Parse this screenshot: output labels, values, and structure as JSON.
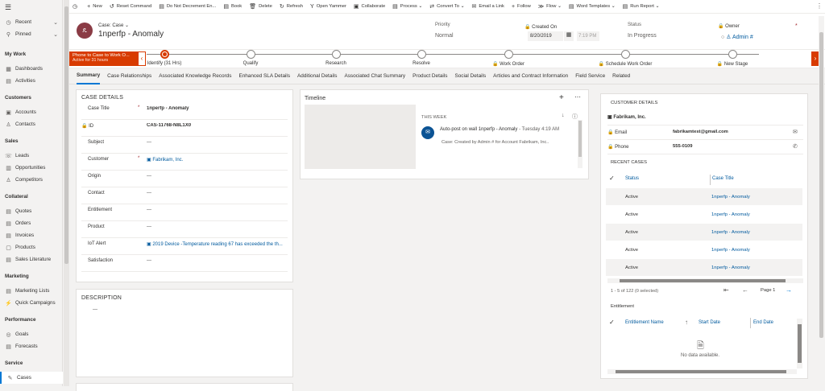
{
  "sidebar": {
    "top_items": [
      {
        "icon": "◷",
        "label": "Recent"
      },
      {
        "icon": "⚲",
        "label": "Pinned"
      }
    ],
    "sections": [
      {
        "title": "My Work",
        "items": [
          {
            "icon": "▦",
            "label": "Dashboards"
          },
          {
            "icon": "▤",
            "label": "Activities"
          }
        ]
      },
      {
        "title": "Customers",
        "items": [
          {
            "icon": "▣",
            "label": "Accounts"
          },
          {
            "icon": "♙",
            "label": "Contacts"
          }
        ]
      },
      {
        "title": "Sales",
        "items": [
          {
            "icon": "☏",
            "label": "Leads"
          },
          {
            "icon": "▥",
            "label": "Opportunities"
          },
          {
            "icon": "♙",
            "label": "Competitors"
          }
        ]
      },
      {
        "title": "Collateral",
        "items": [
          {
            "icon": "▤",
            "label": "Quotes"
          },
          {
            "icon": "▤",
            "label": "Orders"
          },
          {
            "icon": "▤",
            "label": "Invoices"
          },
          {
            "icon": "▢",
            "label": "Products"
          },
          {
            "icon": "▤",
            "label": "Sales Literature"
          }
        ]
      },
      {
        "title": "Marketing",
        "items": [
          {
            "icon": "▤",
            "label": "Marketing Lists"
          },
          {
            "icon": "⚡",
            "label": "Quick Campaigns"
          }
        ]
      },
      {
        "title": "Performance",
        "items": [
          {
            "icon": "◎",
            "label": "Goals"
          },
          {
            "icon": "▤",
            "label": "Forecasts"
          }
        ]
      },
      {
        "title": "Service",
        "items": [
          {
            "icon": "✎",
            "label": "Cases"
          }
        ]
      }
    ],
    "active": "Cases"
  },
  "commands": [
    {
      "icon": "◷",
      "label": ""
    },
    {
      "icon": "+",
      "label": "New"
    },
    {
      "icon": "↺",
      "label": "Reset Command"
    },
    {
      "icon": "▤",
      "label": "Do Not Decrement En..."
    },
    {
      "icon": "▤",
      "label": "Book"
    },
    {
      "icon": "🗑",
      "label": "Delete"
    },
    {
      "icon": "↻",
      "label": "Refresh"
    },
    {
      "icon": "Y",
      "label": "Open Yammer"
    },
    {
      "icon": "▣",
      "label": "Collaborate"
    },
    {
      "icon": "▤",
      "label": "Process ⌄"
    },
    {
      "icon": "⇄",
      "label": "Convert To ⌄"
    },
    {
      "icon": "✉",
      "label": "Email a Link"
    },
    {
      "icon": "+",
      "label": "Follow"
    },
    {
      "icon": "≫",
      "label": "Flow ⌄"
    },
    {
      "icon": "▤",
      "label": "Word Templates ⌄"
    },
    {
      "icon": "▤",
      "label": "Run Report ⌄"
    }
  ],
  "header": {
    "entity": "Case: Case",
    "title": "1nperfp - Anomaly",
    "avatar": "ዴ",
    "fields": [
      {
        "label": "Priority",
        "value": "Normal"
      },
      {
        "label": "Created On",
        "value": "8/20/2019",
        "time": "7:19 PM"
      },
      {
        "label": "Status",
        "value": "In Progress"
      },
      {
        "label": "Owner",
        "value": "Admin #"
      }
    ]
  },
  "bpf": {
    "flag_title": "Phone to Case to Work O...",
    "flag_sub": "Active for 31 hours",
    "stages": [
      "Identify  (31 Hrs)",
      "Qualify",
      "Research",
      "Resolve",
      "Work Order",
      "Schedule Work Order",
      "New Stage"
    ]
  },
  "tabs": [
    "Summary",
    "Case Relationships",
    "Associated Knowledge Records",
    "Enhanced SLA Details",
    "Additional Details",
    "Associated Chat Summary",
    "Product Details",
    "Social Details",
    "Articles and Contract Information",
    "Field Service",
    "Related"
  ],
  "case_details": {
    "title": "CASE DETAILS",
    "fields": [
      {
        "label": "Case Title",
        "value": "1nperfp - Anomaly",
        "req": "*",
        "bold": true
      },
      {
        "label": "ID",
        "value": "CAS-11768-N8L1X0",
        "lock": true,
        "bold": true
      },
      {
        "label": "Subject",
        "value": "---"
      },
      {
        "label": "Customer",
        "value": "Fabrikam, Inc.",
        "req": "*",
        "link": true
      },
      {
        "label": "Origin",
        "value": "---"
      },
      {
        "label": "Contact",
        "value": "---"
      },
      {
        "label": "Entitlement",
        "value": "---"
      },
      {
        "label": "Product",
        "value": "---"
      },
      {
        "label": "IoT Alert",
        "value": "2019 Device -Temperature reading 67 has exceeded the th...",
        "link": true
      },
      {
        "label": "Satisfaction",
        "value": "---"
      }
    ]
  },
  "description": {
    "title": "DESCRIPTION",
    "value": "---"
  },
  "timeline": {
    "title": "Timeline",
    "week": "THIS WEEK",
    "post_title": "Auto-post on wall 1nperfp - Anomaly",
    "post_time": "Tuesday 4:19 AM",
    "post_body": "Case: Created by Admin # for Account Fabrikam, Inc.."
  },
  "customer": {
    "title": "CUSTOMER DETAILS",
    "name": "Fabrikam, Inc.",
    "email_label": "Email",
    "email": "fabrikamtest@gmail.com",
    "phone_label": "Phone",
    "phone": "555-0109"
  },
  "recent_cases": {
    "title": "RECENT CASES",
    "col_status": "Status",
    "col_title": "Case Title",
    "rows": [
      {
        "status": "Active",
        "title": "1nperfp - Anomaly"
      },
      {
        "status": "Active",
        "title": "1nperfp - Anomaly"
      },
      {
        "status": "Active",
        "title": "1nperfp - Anomaly"
      },
      {
        "status": "Active",
        "title": "1nperfp - Anomaly"
      },
      {
        "status": "Active",
        "title": "1nperfp - Anomaly"
      }
    ],
    "paging": "1 - 5 of 122 (0 selected)",
    "page": "Page 1"
  },
  "entitlement": {
    "title": "Entitlement",
    "col_name": "Entitlement Name",
    "col_start": "Start Date",
    "col_end": "End Date",
    "empty": "No data available."
  },
  "colors": {
    "accent": "#0078d4",
    "flag": "#d83b01",
    "link": "#005a9e"
  }
}
